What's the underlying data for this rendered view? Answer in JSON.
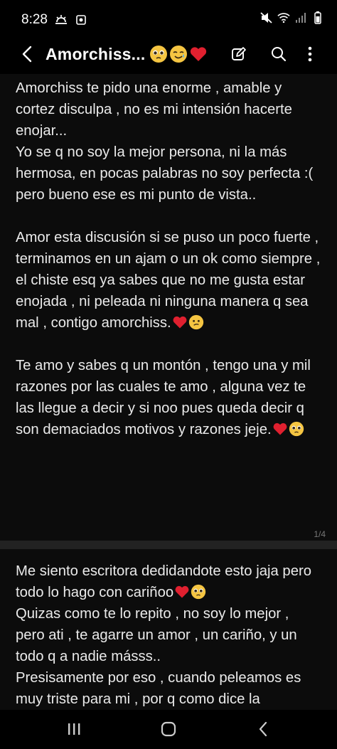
{
  "status_bar": {
    "time": "8:28",
    "icons": [
      "weather-icon",
      "screenshot-icon",
      "mute-icon",
      "wifi-icon",
      "signal-icon",
      "battery-icon"
    ]
  },
  "app_bar": {
    "title": "Amorchiss...",
    "title_emojis": [
      "pleading-face",
      "smiling-face-with-tear",
      "red-heart"
    ],
    "actions": [
      "edit-icon",
      "search-icon",
      "more-icon"
    ]
  },
  "pages": [
    {
      "paragraphs": [
        {
          "text": "Amorchiss te pido una enorme , amable y cortez disculpa , no es mi intensión hacerte enojar...\nYo se q no soy la mejor persona, ni la más hermosa, en pocas palabras no soy perfecta :( pero bueno ese es mi punto de vista..",
          "emojis": []
        },
        {
          "text": "Amor esta discusión si se puso un poco fuerte , terminamos en un ajam o un ok como siempre , el chiste esq ya sabes que no me gusta estar enojada , ni peleada ni ninguna manera q sea mal , contigo amorchiss.",
          "emojis": [
            "red-heart",
            "confused-face"
          ]
        },
        {
          "text": "Te amo y sabes q un montón , tengo una y mil razones por las cuales te amo , alguna vez te las llegue a decir y si noo pues queda decir q son demaciados motivos y razones jeje.",
          "emojis": [
            "red-heart",
            "pleading-face"
          ]
        }
      ],
      "page_indicator": "1/4"
    },
    {
      "paragraphs": [
        {
          "text": "Me siento escritora dedidandote esto jaja pero todo lo hago con cariñoo",
          "emojis": [
            "red-heart",
            "pleading-face"
          ]
        },
        {
          "text": "Quizas como te lo repito , no soy lo mejor , pero ati , te agarre un amor , un cariño, y un todo q a nadie másss..\nPresisamente por eso , cuando peleamos es muy triste para mi , por q como dice la",
          "emojis": []
        }
      ]
    }
  ],
  "nav_bar": {
    "buttons": [
      "recents-icon",
      "home-icon",
      "back-icon"
    ]
  },
  "colors": {
    "background": "#000000",
    "card": "#0c0c0c",
    "separator": "#222222",
    "text": "#eaeaea",
    "heart": "#e0202f",
    "emoji_face": "#f5c542"
  }
}
